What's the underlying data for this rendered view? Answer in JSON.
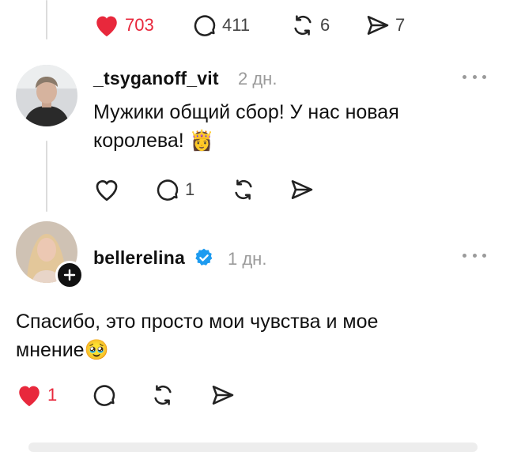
{
  "top_post": {
    "actions": {
      "likes": "703",
      "replies": "411",
      "reposts": "6",
      "shares": "7"
    }
  },
  "comments": [
    {
      "username": "_tsyganoff_vit",
      "time": "2 дн.",
      "text": "Мужики общий сбор! У нас новая королева! 👸",
      "actions": {
        "likes": "",
        "replies": "1",
        "reposts": "",
        "shares": ""
      }
    },
    {
      "username": "bellerelina",
      "verified": true,
      "time": "1 дн.",
      "text": "Спасибо, это просто мои чувства и мое мнение🥹",
      "actions": {
        "likes": "1",
        "replies": "",
        "reposts": "",
        "shares": ""
      }
    }
  ],
  "colors": {
    "like_red": "#e8283c",
    "verified_blue": "#1d9bf0",
    "muted": "#9a9a9a"
  }
}
